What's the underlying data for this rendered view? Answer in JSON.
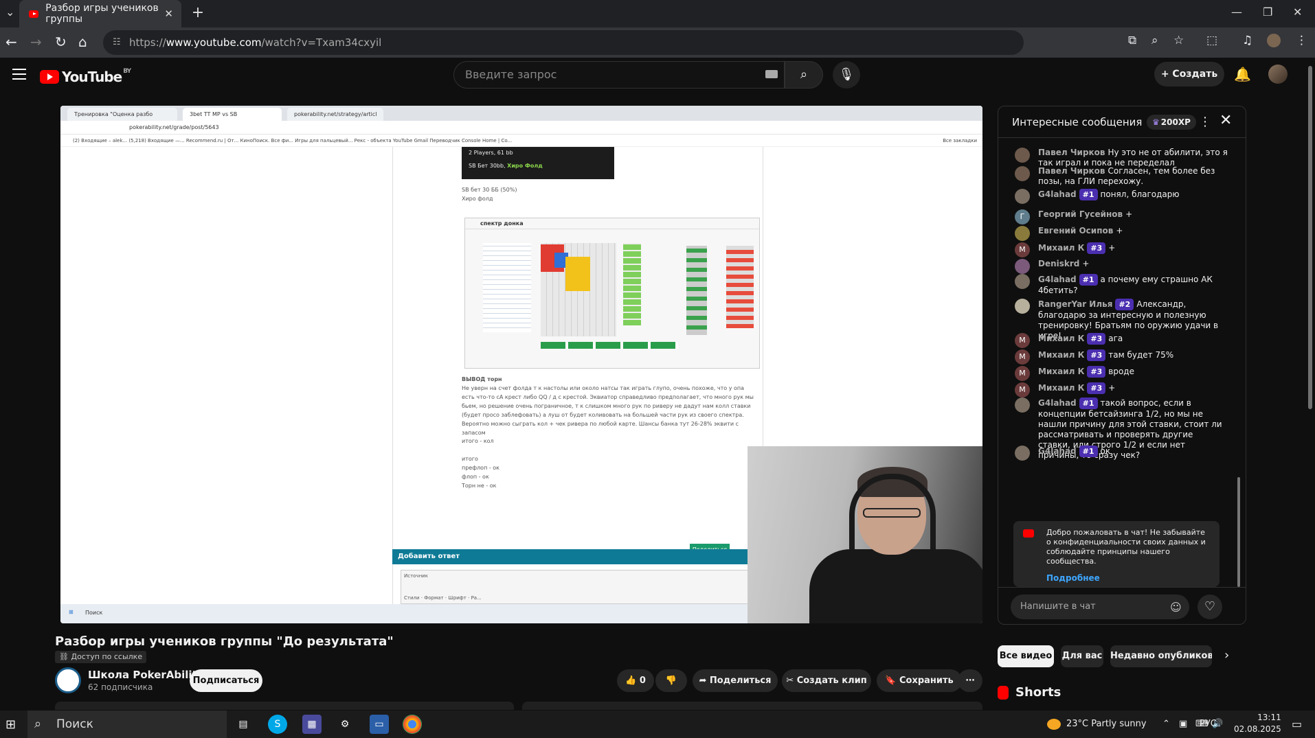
{
  "browser": {
    "tab_title": "Разбор игры учеников группы",
    "url_prefix": "https://",
    "url_domain": "www.youtube.com",
    "url_path": "/watch?v=Txam34cxyil"
  },
  "yt": {
    "logo_text": "YouTube",
    "country": "BY",
    "search_placeholder": "Введите запрос",
    "create_label": "Создать"
  },
  "screen": {
    "tab1": "Тренировка \"Оценка разбо",
    "tab2": "3bet TT MP vs SB",
    "tab3": "pokerability.net/strategy/articl",
    "url": "pokerability.net/grade/post/5643",
    "bookmarks": "(2) Входящие – alek...   (5,218) Входящие —...   Recommend.ru | От...   КиноПоиск. Все фи...   Игры для пальцевый...   Рекс - объекта   YouTube   Gmail   Переводчик   Console Home | Co...",
    "bookmarks_right": "Все закладки",
    "players": "2 Players, 61 bb",
    "sb_bet": "SB Бет 30bb,",
    "hero_fold": "Хиро Фолд",
    "line1": "SB бет 30 ББ (50%)",
    "line2": "Хиро фолд",
    "spectrum_title": "спектр донка",
    "conclusion_title": "ВЫВОД торн",
    "conclusion_text": "Не уверн на счет фолда т к настолы или около натсы так играть глупо, очень похоже, что у опа есть что-то сА крест либо QQ / д с крестой. Эквиатор справедливо предполагает, что много рук мы бьем, но решение очень пограничное, т к слишком много рук по риверу не дадут нам колл ставки (будет просо заблефовать) а луш от будет коливовать на большей части рук из своего спектра. Вероятно можно сыграть кол + чек ривера по любой карте. Шансы банка тут 26-28% эквити с запасом",
    "total": "итого - кол",
    "total2": "итого",
    "preflop": "префлоп - ок",
    "flop": "флоп - ок",
    "turn": "Торн не - ок",
    "share": "Поделиться",
    "reply_header": "Добавить ответ",
    "editor_source": "Источник",
    "editor_styles": "Стили",
    "editor_format": "Формат",
    "editor_font": "Шрифт",
    "editor_size": "Ра...",
    "win_search": "Поиск"
  },
  "video": {
    "title": "Разбор игры учеников группы \"До результата\"",
    "unlisted": "Доступ по ссылке",
    "channel": "Школа PokerAbility",
    "subscribers": "62 подписчика",
    "subscribe": "Подписаться",
    "likes": "0",
    "share": "Поделиться",
    "clip": "Создать клип",
    "save": "Сохранить"
  },
  "chat": {
    "title": "Интересные сообщения",
    "xp": "200XP",
    "messages": [
      {
        "initial": "",
        "color": "#6d5a4c",
        "name": "Павел Чирков",
        "badge": "",
        "text": "Ну это не от абилити, это я так играл и пока не переделал"
      },
      {
        "initial": "",
        "color": "#6d5a4c",
        "name": "Павел Чирков",
        "badge": "",
        "text": "Согласен, тем более без позы, на ГЛИ перехожу."
      },
      {
        "initial": "",
        "color": "#7a6e62",
        "name": "G4lahad",
        "badge": "#1",
        "text": "понял, благодарю"
      },
      {
        "initial": "Г",
        "color": "#5f7d8c",
        "name": "Георгий Гусейнов",
        "badge": "",
        "text": "+"
      },
      {
        "initial": "",
        "color": "#8a7b3c",
        "name": "Евгений Осипов",
        "badge": "",
        "text": "+"
      },
      {
        "initial": "М",
        "color": "#6b3b3b",
        "name": "Михаил К",
        "badge": "#3",
        "text": "+"
      },
      {
        "initial": "",
        "color": "#7b5a7b",
        "name": "Deniskrd",
        "badge": "",
        "text": "+"
      },
      {
        "initial": "",
        "color": "#7a6e62",
        "name": "G4lahad",
        "badge": "#1",
        "text": "а почему ему страшно АК 4бетить?"
      },
      {
        "initial": "",
        "color": "#b7b09c",
        "name": "RangerYar Илья",
        "badge": "#2",
        "text": "Александр, благодарю за интересную и полезную тренировку! Братьям по оружию удачи в игре!"
      },
      {
        "initial": "М",
        "color": "#6b3b3b",
        "name": "Михаил К",
        "badge": "#3",
        "text": "ага"
      },
      {
        "initial": "М",
        "color": "#6b3b3b",
        "name": "Михаил К",
        "badge": "#3",
        "text": "там будет 75%"
      },
      {
        "initial": "М",
        "color": "#6b3b3b",
        "name": "Михаил К",
        "badge": "#3",
        "text": "вроде"
      },
      {
        "initial": "М",
        "color": "#6b3b3b",
        "name": "Михаил К",
        "badge": "#3",
        "text": "+"
      },
      {
        "initial": "",
        "color": "#7a6e62",
        "name": "G4lahad",
        "badge": "#1",
        "text": "такой вопрос, если в концепции бетсайзинга 1/2, но мы не нашли причину для этой ставки, стоит ли рассматривать и проверять другие ставки, или строго 1/2 и если нет причины, то сразу чек?"
      },
      {
        "initial": "",
        "color": "#7a6e62",
        "name": "G4lahad",
        "badge": "#1",
        "text": "ок"
      }
    ],
    "welcome": "Добро пожаловать в чат! Не забывайте о конфиденциальности своих данных и соблюдайте принципы нашего сообщества.",
    "more": "Подробнее",
    "input_placeholder": "Напишите в чат"
  },
  "filters": [
    "Все видео",
    "Для вас",
    "Недавно опубликованн"
  ],
  "shorts": "Shorts",
  "taskbar": {
    "search": "Поиск",
    "weather": "23°C  Partly sunny",
    "lang": "РУС",
    "time": "13:11",
    "date": "02.08.2025"
  }
}
